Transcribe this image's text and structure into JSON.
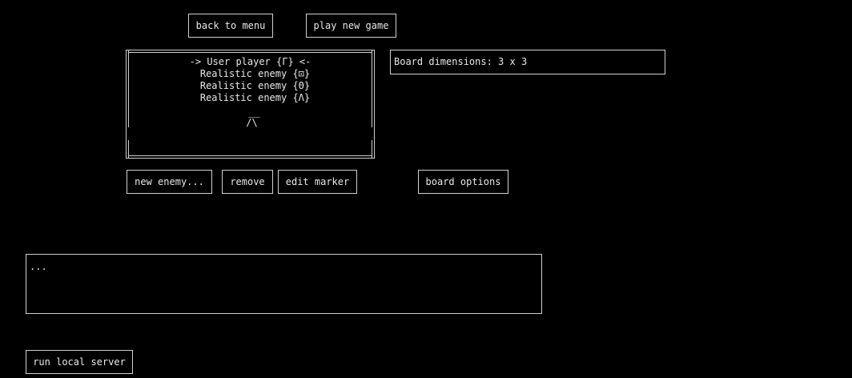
{
  "top_buttons": {
    "back_to_menu": "back to menu",
    "play_new_game": "play new game"
  },
  "player_list": {
    "items": [
      "-> User player {Γ} <-",
      "Realistic enemy {⊡}",
      "Realistic enemy {Θ}",
      "Realistic enemy {Λ}"
    ],
    "selected_index": 0,
    "marker_preview_top": "__",
    "marker_preview_bottom": "/\\"
  },
  "board_info": {
    "dimensions_text": "Board dimensions: 3 x 3"
  },
  "list_buttons": {
    "new_enemy": "new enemy...",
    "remove": "remove",
    "edit_marker": "edit marker",
    "board_options": "board options"
  },
  "log": {
    "text": "..."
  },
  "server": {
    "run_local_server": "run local server"
  },
  "colors": {
    "background": "#000000",
    "foreground": "#e8e8e8",
    "border": "#d0d0d0"
  }
}
